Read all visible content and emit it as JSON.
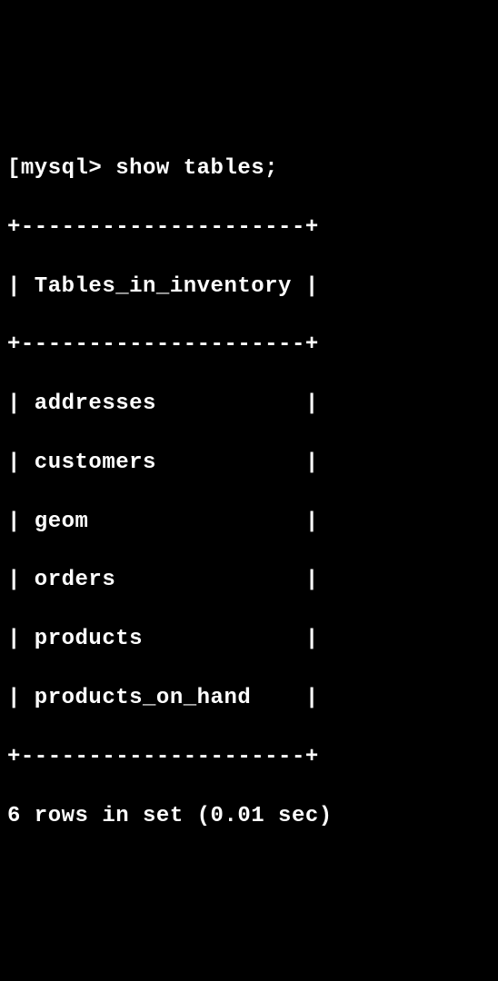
{
  "terminal": {
    "prompt": "[mysql> ",
    "command": "show tables;",
    "border_top": "+---------------------+",
    "header_line": "| Tables_in_inventory |",
    "border_mid": "+---------------------+",
    "rows": [
      "| addresses           |",
      "| customers           |",
      "| geom                |",
      "| orders              |",
      "| products            |",
      "| products_on_hand    |"
    ],
    "border_bottom": "+---------------------+",
    "footer": "6 rows in set (0.01 sec)"
  },
  "chart_data": {
    "type": "table",
    "title": "Tables_in_inventory",
    "columns": [
      "Tables_in_inventory"
    ],
    "rows": [
      [
        "addresses"
      ],
      [
        "customers"
      ],
      [
        "geom"
      ],
      [
        "orders"
      ],
      [
        "products"
      ],
      [
        "products_on_hand"
      ]
    ],
    "row_count": 6,
    "elapsed_sec": 0.01
  }
}
